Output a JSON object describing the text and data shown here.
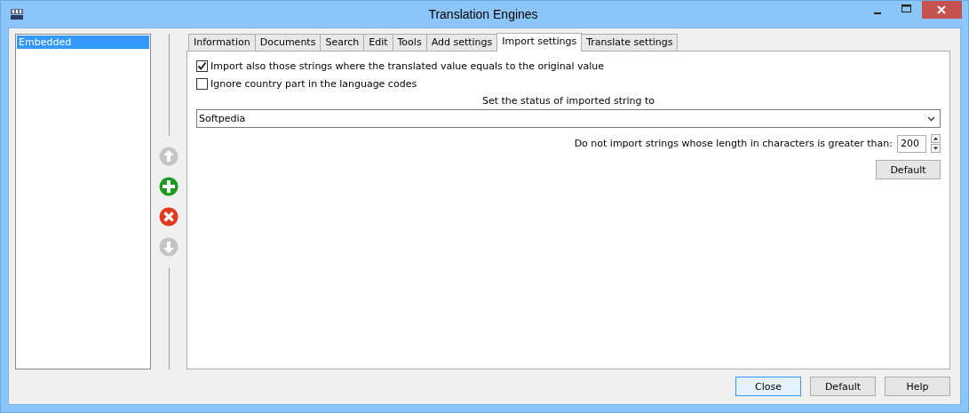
{
  "window": {
    "title": "Translation Engines"
  },
  "engines": [
    {
      "label": "Embedded",
      "selected": true
    }
  ],
  "tabs": [
    {
      "label": "Information",
      "selected": false
    },
    {
      "label": "Documents",
      "selected": false
    },
    {
      "label": "Search",
      "selected": false
    },
    {
      "label": "Edit",
      "selected": false
    },
    {
      "label": "Tools",
      "selected": false
    },
    {
      "label": "Add settings",
      "selected": false
    },
    {
      "label": "Import settings",
      "selected": true
    },
    {
      "label": "Translate settings",
      "selected": false
    }
  ],
  "options": [
    {
      "label": "Import also those strings where the translated value equals to the original value",
      "checked": true
    },
    {
      "label": "Ignore country part in the language codes",
      "checked": false
    }
  ],
  "status": {
    "label": "Set the status of imported string to",
    "value": "Softpedia"
  },
  "max_length": {
    "label": "Do not import strings whose length in characters is greater than:",
    "value": "200"
  },
  "panel_button": "Default",
  "buttons": [
    {
      "label": "Close",
      "selected": true
    },
    {
      "label": "Default",
      "selected": false
    },
    {
      "label": "Help",
      "selected": false
    }
  ]
}
